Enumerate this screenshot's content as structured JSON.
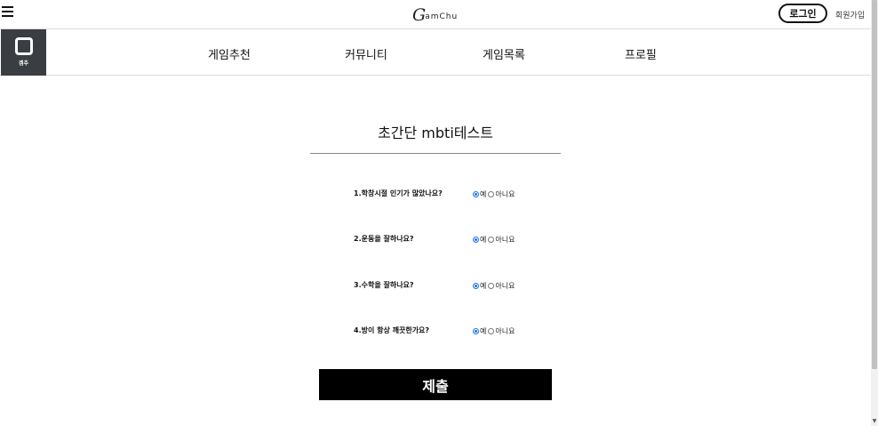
{
  "header": {
    "logo_mark": "G",
    "logo_text": "amChu",
    "login_label": "로그인",
    "signup_label": "회원가입"
  },
  "nav": {
    "brand_label": "겜추",
    "items": [
      "게임추천",
      "커뮤니티",
      "게임목록",
      "프로필"
    ]
  },
  "form": {
    "title": "초간단 mbti테스트",
    "yes_label": "예",
    "no_label": "아니요",
    "questions": [
      {
        "text": "1.학창시절 인기가 많았나요?",
        "selected": "yes"
      },
      {
        "text": "2.운동을 잘하나요?",
        "selected": "yes"
      },
      {
        "text": "3.수학을 잘하나요?",
        "selected": "yes"
      },
      {
        "text": "4.방이 항상 깨끗한가요?",
        "selected": "yes"
      }
    ],
    "submit_label": "제출"
  },
  "icons": {
    "menu": "hamburger-menu-icon",
    "brand": "rounded-square-icon",
    "scroll_down": "triangle-down-icon"
  }
}
